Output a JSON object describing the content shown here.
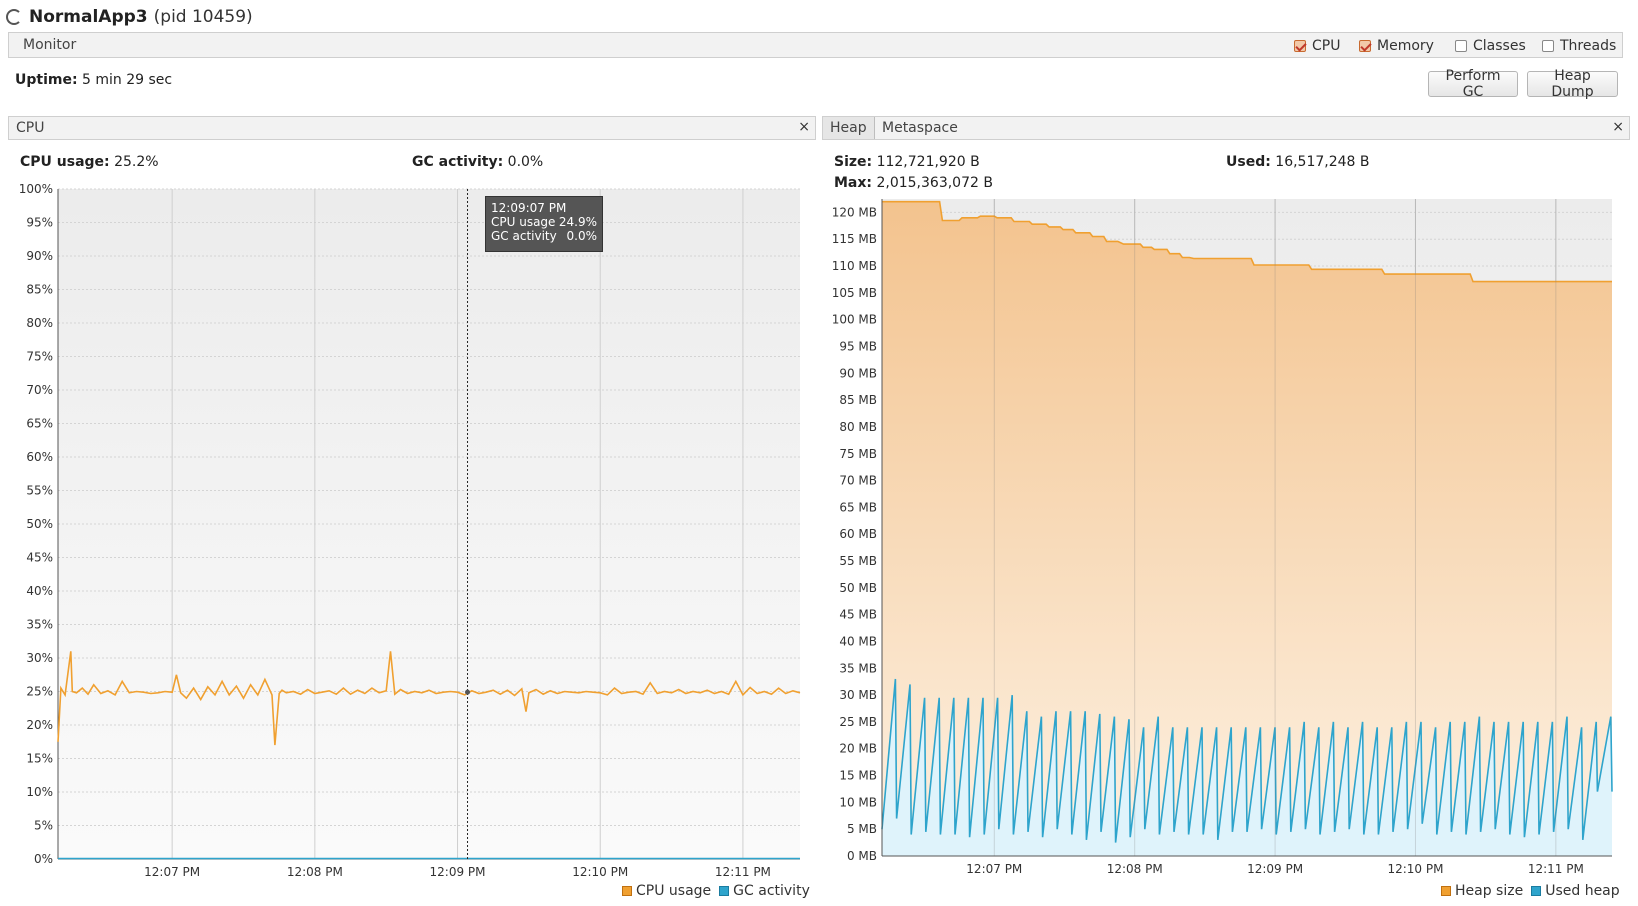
{
  "header": {
    "app_name": "NormalApp3",
    "pid": "(pid 10459)"
  },
  "monitor": {
    "tab_label": "Monitor",
    "checkboxes": [
      {
        "label": "CPU",
        "checked": true
      },
      {
        "label": "Memory",
        "checked": true
      },
      {
        "label": "Classes",
        "checked": false
      },
      {
        "label": "Threads",
        "checked": false
      }
    ],
    "uptime_label": "Uptime:",
    "uptime_value": "5 min 29 sec",
    "perform_gc": "Perform GC",
    "heap_dump": "Heap Dump"
  },
  "cpu_panel": {
    "tab": "CPU",
    "close": "×",
    "usage_label": "CPU usage:",
    "usage_value": "25.2%",
    "gc_label": "GC activity:",
    "gc_value": "0.0%",
    "tooltip": {
      "time": "12:09:07 PM",
      "row1_label": "CPU usage",
      "row1_value": "24.9%",
      "row2_label": "GC activity",
      "row2_value": "0.0%"
    },
    "legend": [
      {
        "label": "CPU usage",
        "color": "#f0a030"
      },
      {
        "label": "GC activity",
        "color": "#2ea4cc"
      }
    ]
  },
  "heap_panel": {
    "tabs": [
      "Heap",
      "Metaspace"
    ],
    "close": "×",
    "size_label": "Size:",
    "size_value": "112,721,920 B",
    "used_label": "Used:",
    "used_value": "16,517,248 B",
    "max_label": "Max:",
    "max_value": "2,015,363,072 B",
    "legend": [
      {
        "label": "Heap size",
        "color": "#f0a030"
      },
      {
        "label": "Used heap",
        "color": "#2ea4cc"
      }
    ]
  },
  "chart_data": [
    {
      "type": "line",
      "title": "",
      "x_ticks": [
        "12:07 PM",
        "12:08 PM",
        "12:09 PM",
        "12:10 PM",
        "12:11 PM"
      ],
      "x_tick_minutes": [
        0.8,
        1.8,
        2.8,
        3.8,
        4.8
      ],
      "x_range_minutes": [
        0,
        5.2
      ],
      "y_ticks": [
        "0%",
        "5%",
        "10%",
        "15%",
        "20%",
        "25%",
        "30%",
        "35%",
        "40%",
        "45%",
        "50%",
        "55%",
        "60%",
        "65%",
        "70%",
        "75%",
        "80%",
        "85%",
        "90%",
        "95%",
        "100%"
      ],
      "ylim": [
        0,
        100
      ],
      "series": [
        {
          "name": "CPU usage",
          "color": "#f0a030",
          "x": [
            0,
            0.02,
            0.05,
            0.09,
            0.1,
            0.13,
            0.17,
            0.21,
            0.25,
            0.3,
            0.35,
            0.4,
            0.45,
            0.5,
            0.55,
            0.6,
            0.65,
            0.7,
            0.75,
            0.8,
            0.83,
            0.86,
            0.9,
            0.95,
            1.0,
            1.05,
            1.1,
            1.15,
            1.2,
            1.25,
            1.3,
            1.35,
            1.4,
            1.45,
            1.5,
            1.52,
            1.55,
            1.57,
            1.6,
            1.65,
            1.7,
            1.75,
            1.8,
            1.85,
            1.9,
            1.95,
            2.0,
            2.05,
            2.1,
            2.15,
            2.2,
            2.25,
            2.3,
            2.33,
            2.36,
            2.4,
            2.45,
            2.5,
            2.55,
            2.6,
            2.65,
            2.7,
            2.75,
            2.8,
            2.85,
            2.9,
            2.95,
            3.0,
            3.05,
            3.1,
            3.15,
            3.2,
            3.25,
            3.28,
            3.3,
            3.35,
            3.4,
            3.45,
            3.5,
            3.55,
            3.6,
            3.65,
            3.7,
            3.75,
            3.8,
            3.85,
            3.9,
            3.95,
            4.0,
            4.05,
            4.1,
            4.15,
            4.2,
            4.25,
            4.3,
            4.35,
            4.4,
            4.45,
            4.5,
            4.55,
            4.6,
            4.65,
            4.7,
            4.75,
            4.8,
            4.85,
            4.9,
            4.95,
            5.0,
            5.05,
            5.1,
            5.15,
            5.2
          ],
          "values": [
            17.5,
            25.5,
            24.5,
            31,
            25,
            24.8,
            25.5,
            24.6,
            26,
            24.7,
            25.1,
            24.5,
            26.5,
            24.8,
            25,
            24.9,
            24.7,
            24.8,
            25,
            24.9,
            27.5,
            24.8,
            24,
            25.5,
            23.8,
            25.7,
            24.5,
            26.5,
            24.5,
            25.8,
            24,
            26,
            24.5,
            26.8,
            24.5,
            17,
            24.7,
            25.2,
            24.8,
            25,
            24.6,
            25.3,
            24.7,
            24.9,
            25.1,
            24.6,
            25.5,
            24.6,
            25.2,
            24.7,
            25.5,
            24.8,
            25.1,
            31,
            24.6,
            25.3,
            24.7,
            25,
            24.8,
            25.2,
            24.7,
            24.9,
            25,
            24.9,
            24.5,
            25.1,
            24.7,
            24.9,
            25.2,
            24.6,
            25.2,
            24.4,
            25.4,
            22,
            24.8,
            25.3,
            24.6,
            25.1,
            24.7,
            25,
            24.9,
            24.8,
            25,
            24.9,
            24.8,
            24.5,
            25.5,
            24.7,
            24.9,
            25,
            24.6,
            26.3,
            24.7,
            25,
            24.8,
            25.3,
            24.7,
            25,
            24.8,
            25.2,
            24.7,
            25,
            24.6,
            26.5,
            24.5,
            25.6,
            24.7,
            25,
            24.6,
            25.5,
            24.7,
            25.1,
            24.8
          ]
        },
        {
          "name": "GC activity",
          "color": "#2ea4cc",
          "x": [
            0,
            5.2
          ],
          "values": [
            0,
            0
          ]
        }
      ],
      "cursor_minute": 2.87
    },
    {
      "type": "area",
      "title": "",
      "x_ticks": [
        "12:07 PM",
        "12:08 PM",
        "12:09 PM",
        "12:10 PM",
        "12:11 PM"
      ],
      "x_tick_minutes": [
        0.8,
        1.8,
        2.8,
        3.8,
        4.8
      ],
      "x_range_minutes": [
        0,
        5.2
      ],
      "y_ticks": [
        "0 MB",
        "5 MB",
        "10 MB",
        "15 MB",
        "20 MB",
        "25 MB",
        "30 MB",
        "35 MB",
        "40 MB",
        "45 MB",
        "50 MB",
        "55 MB",
        "60 MB",
        "65 MB",
        "70 MB",
        "75 MB",
        "80 MB",
        "85 MB",
        "90 MB",
        "95 MB",
        "100 MB",
        "105 MB",
        "110 MB",
        "115 MB",
        "120 MB"
      ],
      "ylim": [
        0,
        122.5
      ],
      "series": [
        {
          "name": "Heap size",
          "color": "#f0a030",
          "x": [
            0,
            0.41,
            0.43,
            0.55,
            0.57,
            0.68,
            0.7,
            0.8,
            0.82,
            0.92,
            0.94,
            1.05,
            1.07,
            1.17,
            1.19,
            1.27,
            1.29,
            1.36,
            1.38,
            1.48,
            1.5,
            1.58,
            1.6,
            1.68,
            1.72,
            1.84,
            1.86,
            1.92,
            1.94,
            2.03,
            2.05,
            2.12,
            2.14,
            2.19,
            2.22,
            2.63,
            2.65,
            3.04,
            3.06,
            3.56,
            3.58,
            4.19,
            4.21,
            5.2
          ],
          "values": [
            122,
            122,
            118.5,
            118.5,
            119,
            119,
            119.3,
            119.3,
            119,
            119,
            118.3,
            118.3,
            117.8,
            117.8,
            117.3,
            117.3,
            116.8,
            116.8,
            116.2,
            116.2,
            115.5,
            115.5,
            114.6,
            114.6,
            114.1,
            114.1,
            113.5,
            113.5,
            113.1,
            113.1,
            112.3,
            112.3,
            111.6,
            111.6,
            111.4,
            111.4,
            110.2,
            110.2,
            109.4,
            109.4,
            108.5,
            108.5,
            107.1,
            107.1
          ]
        },
        {
          "name": "Used heap",
          "color": "#2ea4cc",
          "peaks": [
            33,
            32,
            29.5,
            29.5,
            29.5,
            29.5,
            29.5,
            29.5,
            30,
            27,
            26,
            27,
            27,
            27,
            26.5,
            26,
            25.5,
            24,
            26,
            24,
            24,
            24,
            24,
            24,
            24,
            24,
            24,
            24,
            25,
            24,
            25,
            24,
            25,
            24,
            24,
            25,
            25,
            24,
            25,
            25,
            26,
            25,
            25,
            25,
            25,
            25,
            26,
            24,
            25,
            26
          ],
          "troughs": [
            5,
            7,
            4,
            4.5,
            4,
            4,
            3.5,
            4,
            5,
            4,
            4.5,
            3.5,
            5,
            4,
            3,
            4.5,
            2.5,
            3.5,
            5,
            4,
            4.5,
            4,
            4,
            3,
            4.5,
            4.5,
            5,
            4,
            4.5,
            5,
            4,
            4.5,
            5,
            4,
            4,
            4.5,
            5,
            6,
            4,
            4.5,
            4,
            4.5,
            5,
            4,
            3.5,
            4,
            4.5,
            5,
            3,
            12
          ]
        }
      ]
    }
  ]
}
